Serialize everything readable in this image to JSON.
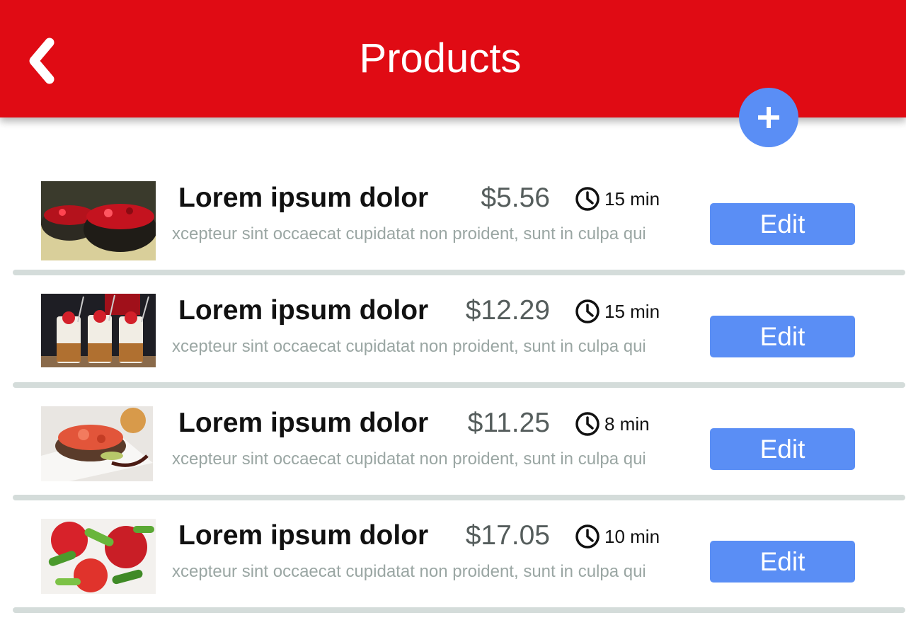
{
  "header": {
    "title": "Products",
    "back_icon": "chevron-left-icon",
    "add_icon": "plus-icon",
    "background_color": "#E00B14",
    "accent_color": "#5A8EF5"
  },
  "products": [
    {
      "title": "Lorem ipsum dolor",
      "price": "$5.56",
      "time": "15 min",
      "description": "xcepteur sint occaecat cupidatat non proident, sunt in culpa qui",
      "edit_label": "Edit",
      "image": "red-cabbage-salad-photo"
    },
    {
      "title": "Lorem ipsum dolor",
      "price": "$12.29",
      "time": "15 min",
      "description": "xcepteur sint occaecat cupidatat non proident, sunt in culpa qui",
      "edit_label": "Edit",
      "image": "parfait-glasses-photo"
    },
    {
      "title": "Lorem ipsum dolor",
      "price": "$11.25",
      "time": "8 min",
      "description": "xcepteur sint occaecat cupidatat non proident, sunt in culpa qui",
      "edit_label": "Edit",
      "image": "plated-dish-photo"
    },
    {
      "title": "Lorem ipsum dolor",
      "price": "$17.05",
      "time": "10 min",
      "description": "xcepteur sint occaecat cupidatat non proident, sunt in culpa qui",
      "edit_label": "Edit",
      "image": "tomato-cucumber-salad-photo"
    }
  ]
}
